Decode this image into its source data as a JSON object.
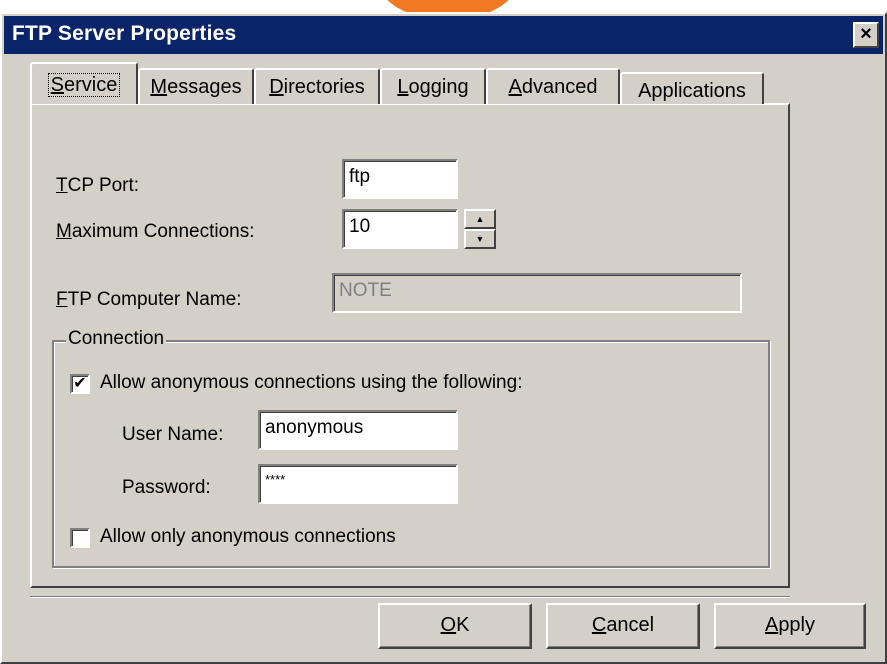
{
  "window": {
    "title": "FTP Server Properties",
    "close_glyph": "×"
  },
  "tabs": [
    {
      "mnemonic": "S",
      "rest": "ervice",
      "active": true
    },
    {
      "mnemonic": "M",
      "rest": "essages",
      "active": false
    },
    {
      "mnemonic": "D",
      "rest": "irectories",
      "active": false
    },
    {
      "mnemonic": "L",
      "rest": "ogging",
      "active": false
    },
    {
      "mnemonic": "A",
      "rest": "dvanced",
      "active": false
    },
    {
      "mnemonic": "",
      "rest": "Applications",
      "active": false
    }
  ],
  "service": {
    "tcp_port": {
      "mnemonic": "T",
      "rest": "CP Port:",
      "value": "ftp"
    },
    "max_connections": {
      "mnemonic": "M",
      "rest": "aximum Connections:",
      "value": "10",
      "up_glyph": "▲",
      "down_glyph": "▼"
    },
    "computer_name": {
      "mnemonic": "F",
      "rest": "TP Computer Name:",
      "value": "NOTE",
      "disabled": true
    }
  },
  "connection": {
    "group_label": "Connection",
    "allow_anonymous": {
      "label": "Allow anonymous connections using the following:",
      "checked": true,
      "check_glyph": "✔"
    },
    "user_name": {
      "label": "User Name:",
      "value": "anonymous"
    },
    "password": {
      "label": "Password:",
      "value": "****"
    },
    "only_anonymous": {
      "label": "Allow only anonymous connections",
      "checked": false
    }
  },
  "buttons": {
    "ok": {
      "mnemonic": "O",
      "rest": "K"
    },
    "cancel": {
      "mnemonic": "C",
      "rest": "ancel"
    },
    "apply": {
      "mnemonic": "A",
      "rest": "pply"
    }
  },
  "colors": {
    "titlebar": "#0a246a",
    "face": "#d4d0c8",
    "accent_arc": "#f07a22"
  }
}
